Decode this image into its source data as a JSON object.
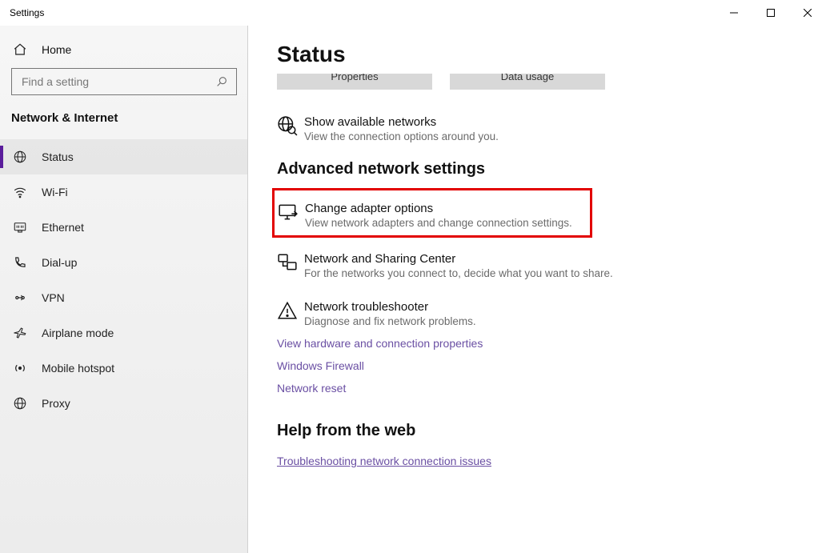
{
  "window": {
    "title": "Settings"
  },
  "sidebar": {
    "home": "Home",
    "searchPlaceholder": "Find a setting",
    "group": "Network & Internet",
    "items": [
      {
        "label": "Status"
      },
      {
        "label": "Wi-Fi"
      },
      {
        "label": "Ethernet"
      },
      {
        "label": "Dial-up"
      },
      {
        "label": "VPN"
      },
      {
        "label": "Airplane mode"
      },
      {
        "label": "Mobile hotspot"
      },
      {
        "label": "Proxy"
      }
    ]
  },
  "main": {
    "title": "Status",
    "buttons": {
      "0": "Properties",
      "1": "Data usage"
    },
    "showNetworks": {
      "title": "Show available networks",
      "desc": "View the connection options around you."
    },
    "advTitle": "Advanced network settings",
    "adv": [
      {
        "title": "Change adapter options",
        "desc": "View network adapters and change connection settings."
      },
      {
        "title": "Network and Sharing Center",
        "desc": "For the networks you connect to, decide what you want to share."
      },
      {
        "title": "Network troubleshooter",
        "desc": "Diagnose and fix network problems."
      }
    ],
    "links": {
      "hw": "View hardware and connection properties",
      "fw": "Windows Firewall",
      "reset": "Network reset"
    },
    "helpTitle": "Help from the web",
    "helpLink": "Troubleshooting network connection issues"
  }
}
